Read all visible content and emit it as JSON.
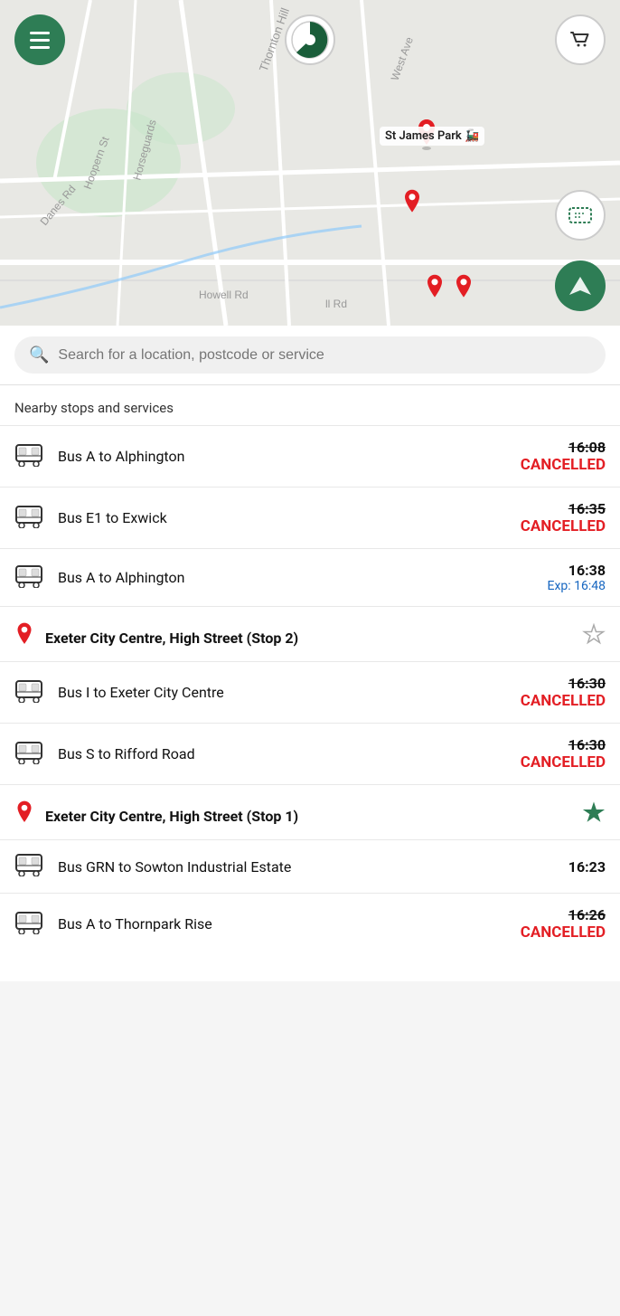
{
  "map": {
    "pie_label": "pie-chart",
    "menu_label": "menu",
    "cart_label": "cart",
    "ticket_label": "ticket",
    "location_label": "my-location",
    "stop_label": "St James Park",
    "train_icon": "🚂"
  },
  "search": {
    "placeholder": "Search for a location, postcode or service"
  },
  "nearby_section": {
    "title": "Nearby stops and services"
  },
  "top_services": [
    {
      "name": "Bus A to Alphington",
      "time_strikethrough": "16:08",
      "time_cancelled": "CANCELLED",
      "status": "cancelled"
    },
    {
      "name": "Bus E1 to Exwick",
      "time_strikethrough": "16:35",
      "time_cancelled": "CANCELLED",
      "status": "cancelled"
    },
    {
      "name": "Bus A to Alphington",
      "time_normal": "16:38",
      "time_expected": "Exp: 16:48",
      "status": "expected"
    }
  ],
  "stops": [
    {
      "id": "stop1",
      "name": "Exeter City Centre, High Street (Stop 2)",
      "starred": false,
      "services": [
        {
          "name": "Bus I to Exeter City Centre",
          "time_strikethrough": "16:30",
          "time_cancelled": "CANCELLED",
          "status": "cancelled"
        },
        {
          "name": "Bus S to Rifford Road",
          "time_strikethrough": "16:30",
          "time_cancelled": "CANCELLED",
          "status": "cancelled"
        }
      ]
    },
    {
      "id": "stop2",
      "name": "Exeter City Centre, High Street (Stop 1)",
      "starred": true,
      "services": [
        {
          "name": "Bus GRN to Sowton Industrial Estate",
          "time_normal": "16:23",
          "status": "normal"
        },
        {
          "name": "Bus A to Thornpark Rise",
          "time_strikethrough": "16:26",
          "time_cancelled": "CANCELLED",
          "status": "cancelled"
        }
      ]
    }
  ],
  "icons": {
    "search": "🔍",
    "bus": "🚌",
    "pin": "📍",
    "star_filled": "★",
    "star_outline": "☆",
    "cart": "🛒",
    "ticket": "🎫",
    "navigation": "➤"
  }
}
